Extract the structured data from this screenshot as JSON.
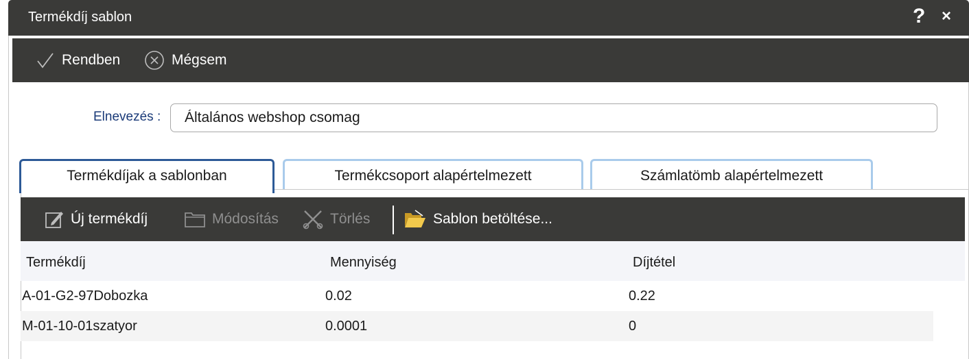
{
  "dialog": {
    "title": "Termékdíj sablon",
    "help_label": "?",
    "close_label": "×"
  },
  "toolbar": {
    "ok_label": "Rendben",
    "cancel_label": "Mégsem"
  },
  "form": {
    "name_label": "Elnevezés",
    "name_separator": ":",
    "name_value": "Általános webshop csomag"
  },
  "tabs": [
    {
      "label": "Termékdíjak a sablonban",
      "active": true
    },
    {
      "label": "Termékcsoport alapértelmezett",
      "active": false
    },
    {
      "label": "Számlatömb alapértelmezett",
      "active": false
    }
  ],
  "grid_toolbar": {
    "new_label": "Új termékdíj",
    "edit_label": "Módosítás",
    "delete_label": "Törlés",
    "load_label": "Sablon betöltése..."
  },
  "grid": {
    "columns": [
      "Termékdíj",
      "Mennyiség",
      "Díjtétel"
    ],
    "rows": [
      [
        "A-01-G2-97Dobozka",
        "0.02",
        "0.22"
      ],
      [
        "M-01-10-01szatyor",
        "0.0001",
        "0"
      ]
    ]
  },
  "colors": {
    "toolbar_bg": "#3a3a38",
    "label_blue": "#1a3a78",
    "tab_active_border": "#2d5a97",
    "tab_border": "#a9cbeb"
  },
  "icons": {
    "ok": "checkmark-icon",
    "cancel": "cancel-circle-icon",
    "new": "edit-pencil-icon",
    "edit": "folder-icon",
    "delete": "scissors-icon",
    "load": "open-folder-icon"
  }
}
